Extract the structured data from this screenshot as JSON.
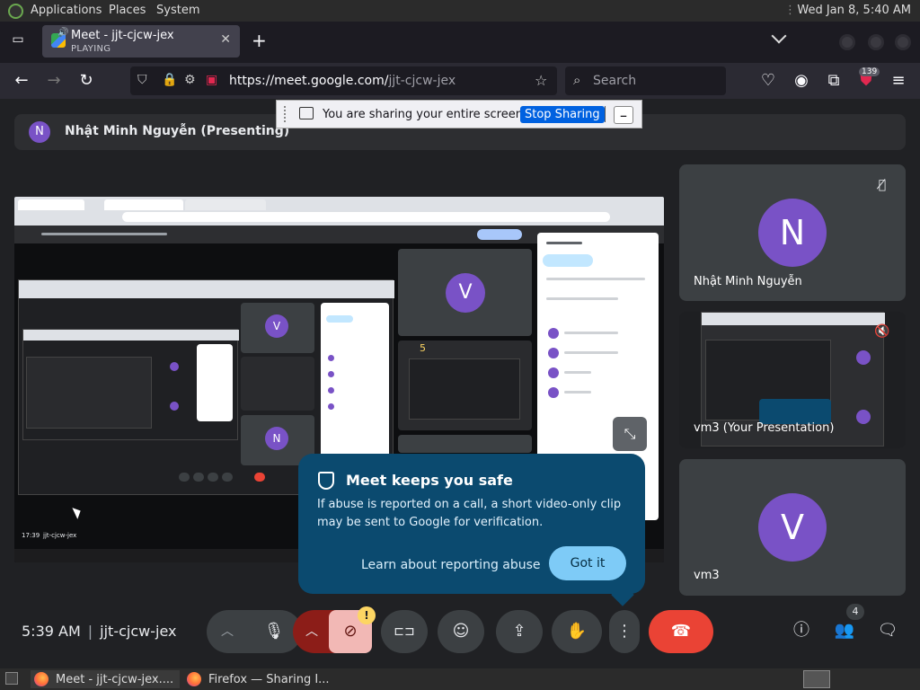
{
  "topbar": {
    "applications": "Applications",
    "places": "Places",
    "system": "System",
    "clock": "Wed Jan  8,  5:40 AM"
  },
  "browser": {
    "tab": {
      "title": "Meet - jjt-cjcw-jex",
      "status": "PLAYING"
    },
    "url": {
      "host": "https://meet.google.com/",
      "path": "jjt-cjcw-jex"
    },
    "search_placeholder": "Search",
    "extension_badge": "139"
  },
  "sharing_bar": {
    "message": "You are sharing your entire screen.",
    "stop_label": "Stop Sharing"
  },
  "presenting": {
    "avatar_letter": "N",
    "name": "Nhật Minh Nguyễn (Presenting)"
  },
  "participants": [
    {
      "letter": "N",
      "name": "Nhật Minh Nguyễn"
    },
    {
      "name": "vm3 (Your Presentation)"
    },
    {
      "letter": "V",
      "name": "vm3"
    }
  ],
  "safe_popup": {
    "title": "Meet keeps you safe",
    "body": "If abuse is reported on a call, a short video-only clip may be sent to Google for verification.",
    "learn_link": "Learn about reporting abuse",
    "got_it": "Got it"
  },
  "meeting": {
    "time": "5:39 AM",
    "code": "jjt-cjcw-jex",
    "people_count": "4",
    "alert_mark": "!"
  },
  "taskbar": {
    "items": [
      "Meet - jjt-cjcw-jex....",
      "Firefox — Sharing I..."
    ]
  },
  "shared_screen": {
    "tile_letter_v": "V",
    "tile_letter_n": "N",
    "time_text": "17:39",
    "code_text": "jjt-cjcw-jex",
    "hand_count": "5"
  }
}
